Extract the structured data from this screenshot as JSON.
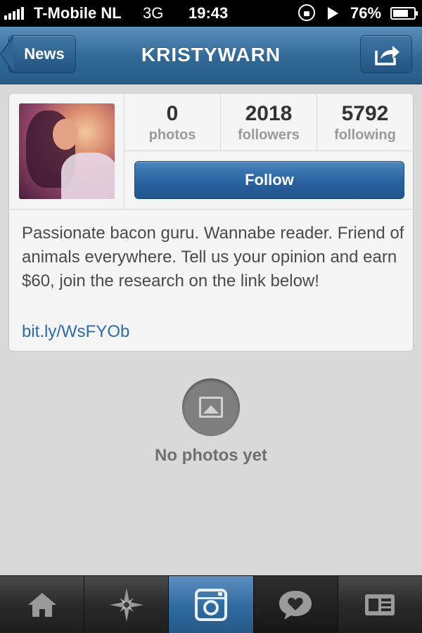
{
  "status_bar": {
    "carrier": "T-Mobile NL",
    "network": "3G",
    "time": "19:43",
    "battery_percent": "76%",
    "battery_level": 0.76,
    "icons": [
      "signal-icon",
      "rotation-lock-icon",
      "play-icon",
      "battery-icon"
    ]
  },
  "nav": {
    "back_label": "News",
    "title": "KRISTYWARN",
    "share_icon": "share-icon"
  },
  "profile": {
    "stats": [
      {
        "value": "0",
        "label": "photos"
      },
      {
        "value": "2018",
        "label": "followers"
      },
      {
        "value": "5792",
        "label": "following"
      }
    ],
    "follow_label": "Follow",
    "bio": "Passionate bacon guru. Wannabe reader. Friend of animals everywhere. Tell us your opinion and earn $60, join the research on the link below!",
    "link": "bit.ly/WsFYOb"
  },
  "empty_state": {
    "icon": "photo-placeholder-icon",
    "text": "No photos yet"
  },
  "tab_bar": {
    "tabs": [
      {
        "name": "home-icon"
      },
      {
        "name": "explore-icon"
      },
      {
        "name": "camera-icon",
        "active": true
      },
      {
        "name": "activity-icon"
      },
      {
        "name": "profile-icon"
      }
    ]
  },
  "colors": {
    "nav_blue": "#2f6896",
    "follow_blue": "#2a62a0",
    "link_blue": "#2f6aa6",
    "background": "#d9d9d9"
  }
}
